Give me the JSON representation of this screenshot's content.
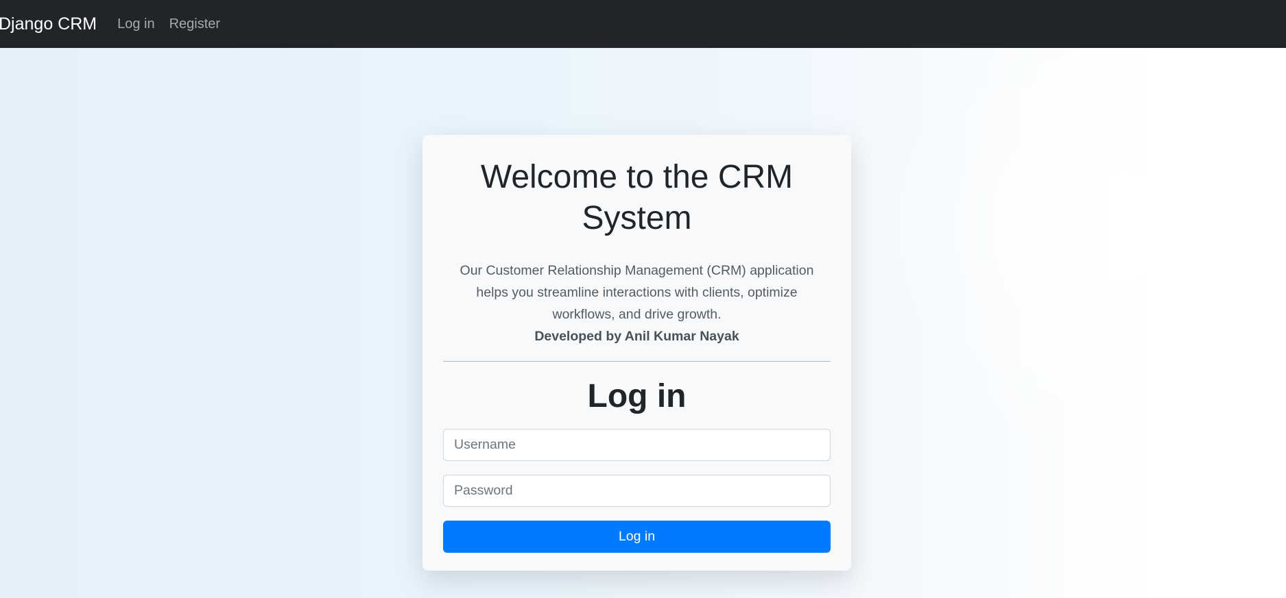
{
  "navbar": {
    "brand": "Django CRM",
    "links": [
      "Log in",
      "Register"
    ]
  },
  "card": {
    "welcome_title": "Welcome to the CRM System",
    "description": "Our Customer Relationship Management (CRM) application helps you streamline interactions with clients, optimize workflows, and drive growth.",
    "credit": "Developed by Anil Kumar Nayak",
    "login_heading": "Log in",
    "username_placeholder": "Username",
    "password_placeholder": "Password",
    "submit_label": "Log in"
  },
  "colors": {
    "navbar_bg": "#212529",
    "primary_button": "#007bff",
    "card_bg": "#f8f9fa"
  }
}
